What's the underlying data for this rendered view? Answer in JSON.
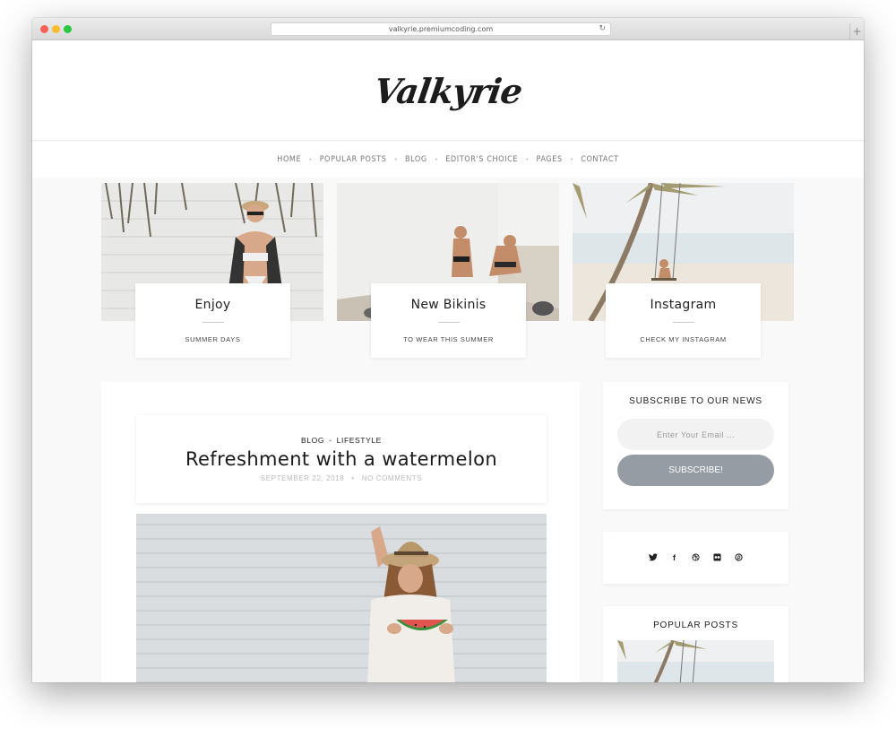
{
  "browser": {
    "url": "valkyrie.premiumcoding.com",
    "reload_icon": "reload-icon",
    "new_tab": "+"
  },
  "site": {
    "logo": "Valkyrie"
  },
  "nav": {
    "items": [
      "HOME",
      "POPULAR POSTS",
      "BLOG",
      "EDITOR'S CHOICE",
      "PAGES",
      "CONTACT"
    ]
  },
  "features": [
    {
      "title": "Enjoy",
      "subtitle": "SUMMER DAYS"
    },
    {
      "title": "New Bikinis",
      "subtitle": "TO WEAR THIS SUMMER"
    },
    {
      "title": "Instagram",
      "subtitle": "CHECK MY INSTAGRAM"
    }
  ],
  "post": {
    "categories": [
      "BLOG",
      "LIFESTYLE"
    ],
    "title": "Refreshment with a watermelon",
    "date": "SEPTEMBER 22, 2018",
    "comments": "NO COMMENTS"
  },
  "sidebar": {
    "subscribe": {
      "title": "SUBSCRIBE TO OUR NEWS",
      "placeholder": "Enter Your Email ...",
      "button": "SUBSCRIBE!"
    },
    "social_icons": [
      "twitter-icon",
      "facebook-icon",
      "dribbble-icon",
      "flickr-icon",
      "pinterest-icon"
    ],
    "popular": {
      "title": "POPULAR POSTS"
    }
  },
  "colors": {
    "accent_button": "#959ca3",
    "page_bg": "#f9f9f9"
  }
}
